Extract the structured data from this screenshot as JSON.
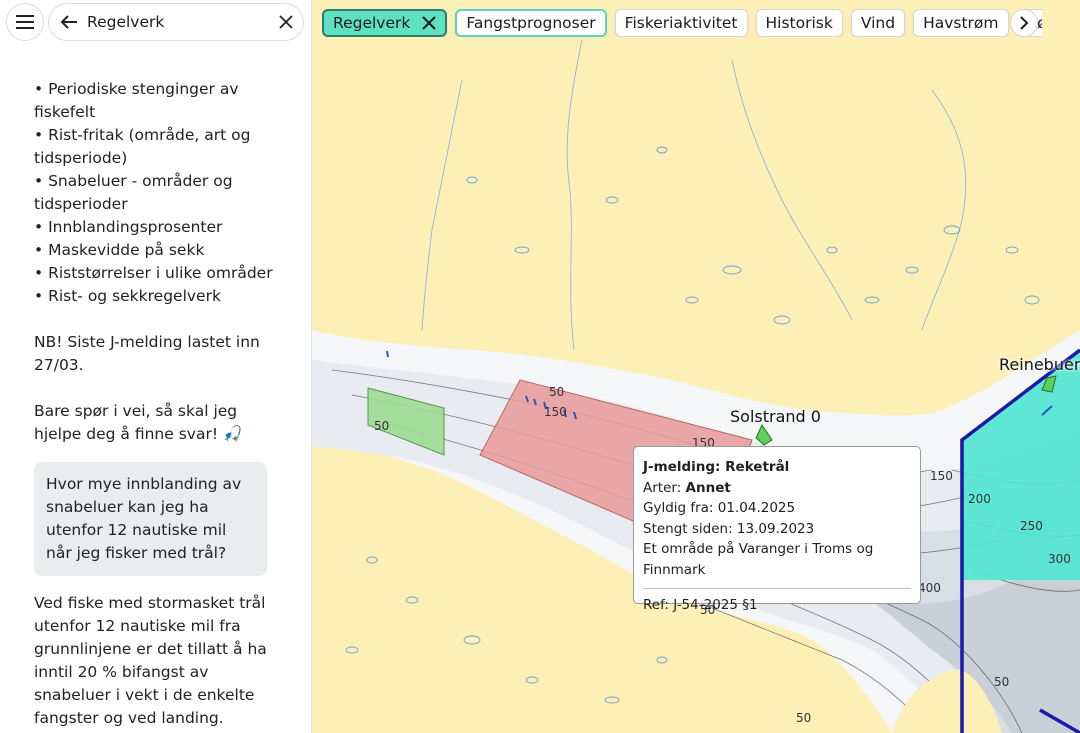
{
  "search": {
    "value": "Regelverk"
  },
  "chat": {
    "intro_items": [
      "• Periodiske stenginger av fiskefelt",
      "• Rist-fritak (område, art og tidsperiode)",
      "• Snabeluer - områder og tidsperioder",
      "• Innblandingsprosenter",
      "• Maskevidde på sekk",
      "• Riststørrelser i ulike områder",
      "• Rist- og sekkregelverk"
    ],
    "note": "NB! Siste J-melding lastet inn 27/03.",
    "offer": "Bare spør i vei, så skal jeg hjelpe deg å finne svar! 🎣",
    "user_question": "Hvor mye innblanding av snabeluer kan jeg ha utenfor 12 nautiske mil når jeg fisker med trål?",
    "answer": "Ved fiske med stormasket trål utenfor 12 nautiske mil fra grunnlinjene er det tillatt å ha inntil 20 % bifangst av snabeluer i vekt i de enkelte fangster og ved landing."
  },
  "chips": [
    {
      "label": "Regelverk",
      "state": "active"
    },
    {
      "label": "Fangstprognoser",
      "state": "outlined"
    },
    {
      "label": "Fiskeriaktivitet",
      "state": "normal"
    },
    {
      "label": "Historisk",
      "state": "normal"
    },
    {
      "label": "Vind",
      "state": "normal"
    },
    {
      "label": "Havstrøm",
      "state": "normal"
    },
    {
      "label": "Bølg",
      "state": "normal"
    }
  ],
  "map": {
    "places": {
      "solstrand": "Solstrand 0",
      "reinebuen": "Reinebuen"
    },
    "depth_labels": [
      "50",
      "50",
      "150",
      "150",
      "100",
      "150",
      "200",
      "250",
      "300",
      "400",
      "50",
      "50",
      "50"
    ],
    "colors": {
      "land": "#fcf0b7",
      "water": "#f4f6f8",
      "red_zone": "#e89a9a",
      "green_zone": "#9ddc94",
      "teal_zone": "#4fe6d0",
      "boundary": "#1a1aa8"
    }
  },
  "popup": {
    "title": "J-melding: Reketrål",
    "species_label": "Arter: ",
    "species_value": "Annet",
    "valid_from": "Gyldig fra: 01.04.2025",
    "closed_since": "Stengt siden: 13.09.2023",
    "area": "Et område på Varanger i Troms og Finnmark",
    "ref": "Ref: J-54-2025 §1"
  },
  "icons": {
    "menu": "hamburger-icon",
    "back": "arrow-left-icon",
    "clear": "close-icon",
    "chip_close": "close-icon",
    "chips_next": "chevron-right-icon"
  }
}
